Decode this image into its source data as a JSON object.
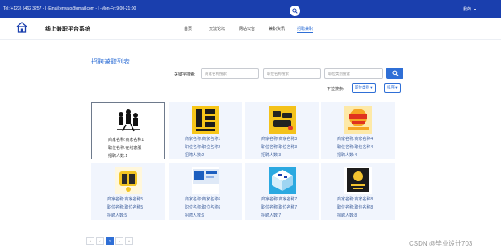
{
  "topbar": {
    "contact": "Tel:(+123) 5462 3257 - | -Email:envato@gmail.com - | -Mon-Fri:9:00-21:00",
    "search_icon": "search-icon",
    "user_label": "我的",
    "user_caret": "▾"
  },
  "navbar": {
    "logo_icon": "home-icon",
    "brand": "线上兼职平台系统",
    "menu": [
      {
        "label": "首页"
      },
      {
        "label": "交流论坛"
      },
      {
        "label": "网站公告"
      },
      {
        "label": "兼职资讯"
      },
      {
        "label": "招聘兼职"
      }
    ],
    "active": "招聘兼职"
  },
  "page_title": "招聘兼职列表",
  "search": {
    "label": "关键字搜索:",
    "merchant_placeholder": "商家名称搜索",
    "position_placeholder": "职位名称搜索",
    "category_placeholder": "职位类别搜索"
  },
  "filter": {
    "label": "下拉搜索:",
    "category_button": "职位类别 ▾",
    "sort_button": "排序 ▾"
  },
  "cards": [
    {
      "merchant": "商家名称:商家名称1",
      "position": "职位名称:在线客服",
      "count": "招聘人数:1",
      "image_icon": "silhouette-people-image"
    },
    {
      "merchant": "商家名称:商家名称1",
      "position": "职位名称:职位名称2",
      "count": "招聘人数:2",
      "image_icon": "yellow-poster-image"
    },
    {
      "merchant": "商家名称:商家名称3",
      "position": "职位名称:职位名称3",
      "count": "招聘人数:3",
      "image_icon": "recruit-text-poster-image"
    },
    {
      "merchant": "商家名称:商家名称4",
      "position": "职位名称:职位名称4",
      "count": "招聘人数:4",
      "image_icon": "orange-recruit-poster-image"
    },
    {
      "merchant": "商家名称:商家名称5",
      "position": "职位名称:职位名称5",
      "count": "招聘人数:5",
      "image_icon": "gold-recruit-poster-image"
    },
    {
      "merchant": "商家名称:商家名称6",
      "position": "职位名称:职位名称6",
      "count": "招聘人数:6",
      "image_icon": "blue-banner-image"
    },
    {
      "merchant": "商家名称:商家名称7",
      "position": "职位名称:职位名称7",
      "count": "招聘人数:7",
      "image_icon": "isometric-office-image"
    },
    {
      "merchant": "商家名称:商家名称8",
      "position": "职位名称:职位名称8",
      "count": "招聘人数:8",
      "image_icon": "dark-recruit-poster-image"
    }
  ],
  "pagination": {
    "first": "«",
    "prev": "‹",
    "current": "1",
    "next": "›",
    "last": "»"
  },
  "watermark": "CSDN @毕业设计703"
}
